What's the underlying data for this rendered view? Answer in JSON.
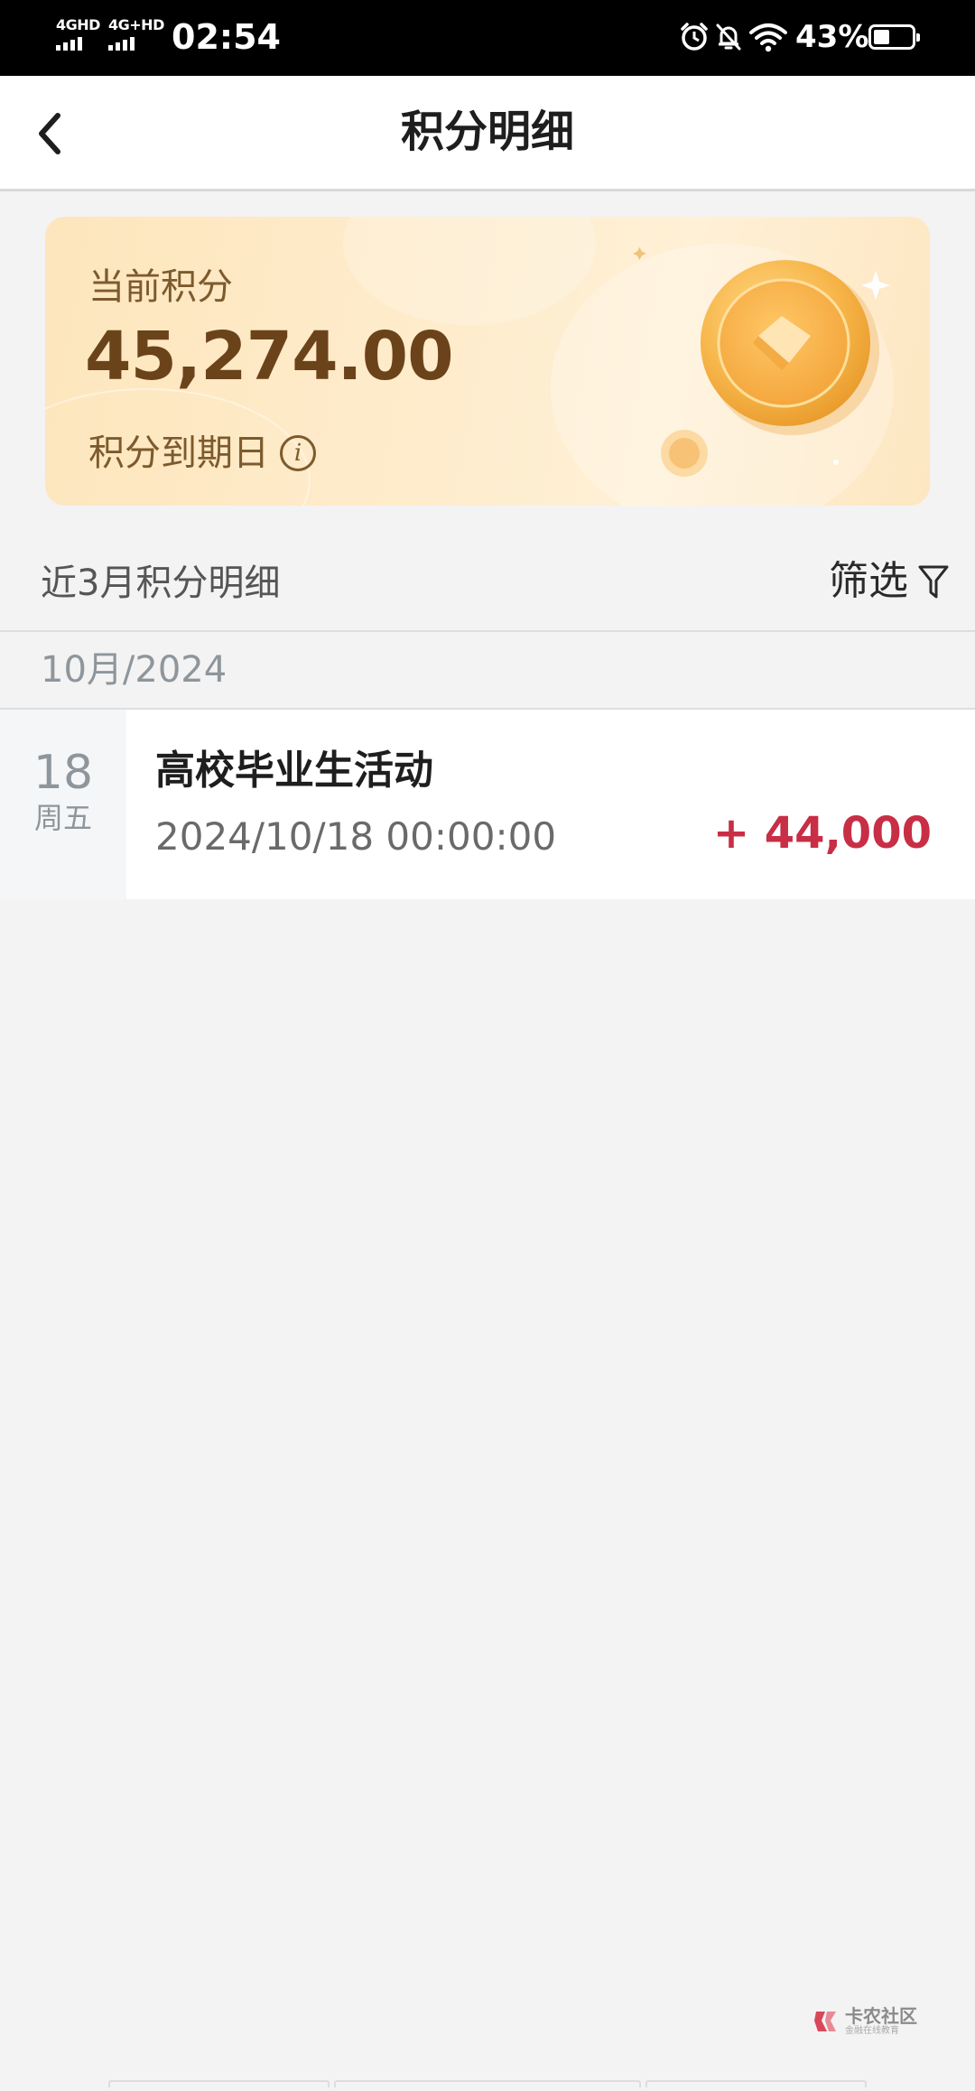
{
  "status_bar": {
    "signal_1": "4GHD",
    "signal_2": "4G+HD",
    "time": "02:54",
    "battery": "43%",
    "battery_level": 0.43,
    "icons": [
      "alarm-icon",
      "bell-off-icon",
      "wifi-icon",
      "battery-icon"
    ]
  },
  "nav": {
    "title": "积分明细",
    "back_icon": "chevron-left-icon"
  },
  "points_card": {
    "label": "当前积分",
    "value": "45,274.00",
    "expiry_label": "积分到期日",
    "info_symbol": "i"
  },
  "history": {
    "title": "近3月积分明细",
    "filter_label": "筛选",
    "filter_icon": "funnel-icon",
    "months": [
      {
        "label": "10月/2024",
        "records": [
          {
            "day": "18",
            "weekday": "周五",
            "title": "高校毕业生活动",
            "datetime": "2024/10/18 00:00:00",
            "amount": "+ 44,000"
          }
        ]
      }
    ]
  },
  "watermark": {
    "brand": "卡农社区",
    "tagline": "金融在线教育"
  },
  "colors": {
    "accent_red": "#c82e45",
    "card_text": "#6b431a",
    "card_bg": "#fde6bd"
  }
}
